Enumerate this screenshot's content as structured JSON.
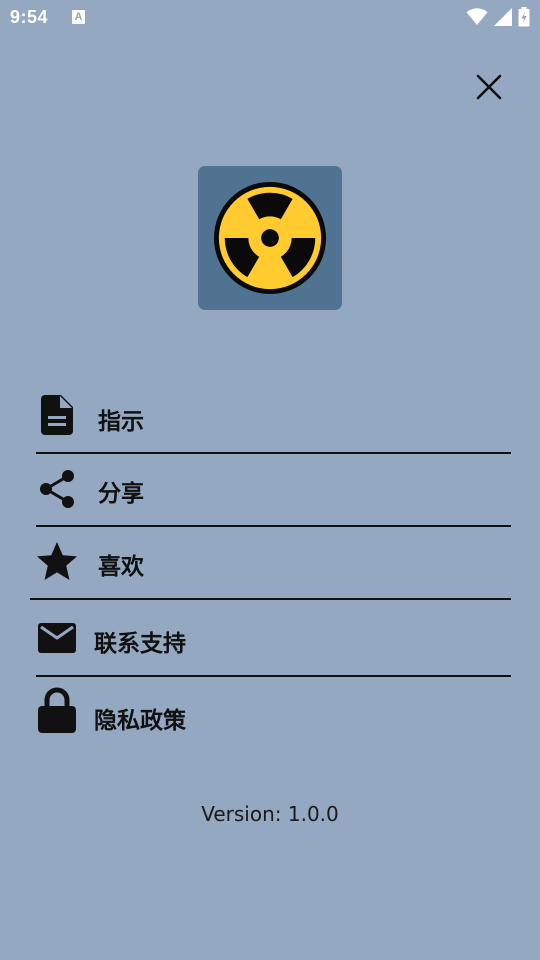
{
  "status_bar": {
    "time": "9:54",
    "notification_icon": "A",
    "icons": [
      "wifi-icon",
      "signal-icon",
      "battery-icon"
    ]
  },
  "header": {
    "close_icon": "close-icon"
  },
  "logo": {
    "icon": "radiation-icon",
    "bg_color": "#4f7391",
    "symbol_color": "#ffcb2e"
  },
  "menu": {
    "items": [
      {
        "label": "指示",
        "icon": "document-icon"
      },
      {
        "label": "分享",
        "icon": "share-icon"
      },
      {
        "label": "喜欢",
        "icon": "star-icon"
      },
      {
        "label": "联系支持",
        "icon": "mail-icon"
      },
      {
        "label": "隐私政策",
        "icon": "lock-icon"
      }
    ]
  },
  "footer": {
    "version": "Version: 1.0.0"
  },
  "colors": {
    "background": "#95a8c2",
    "text": "#111111"
  }
}
